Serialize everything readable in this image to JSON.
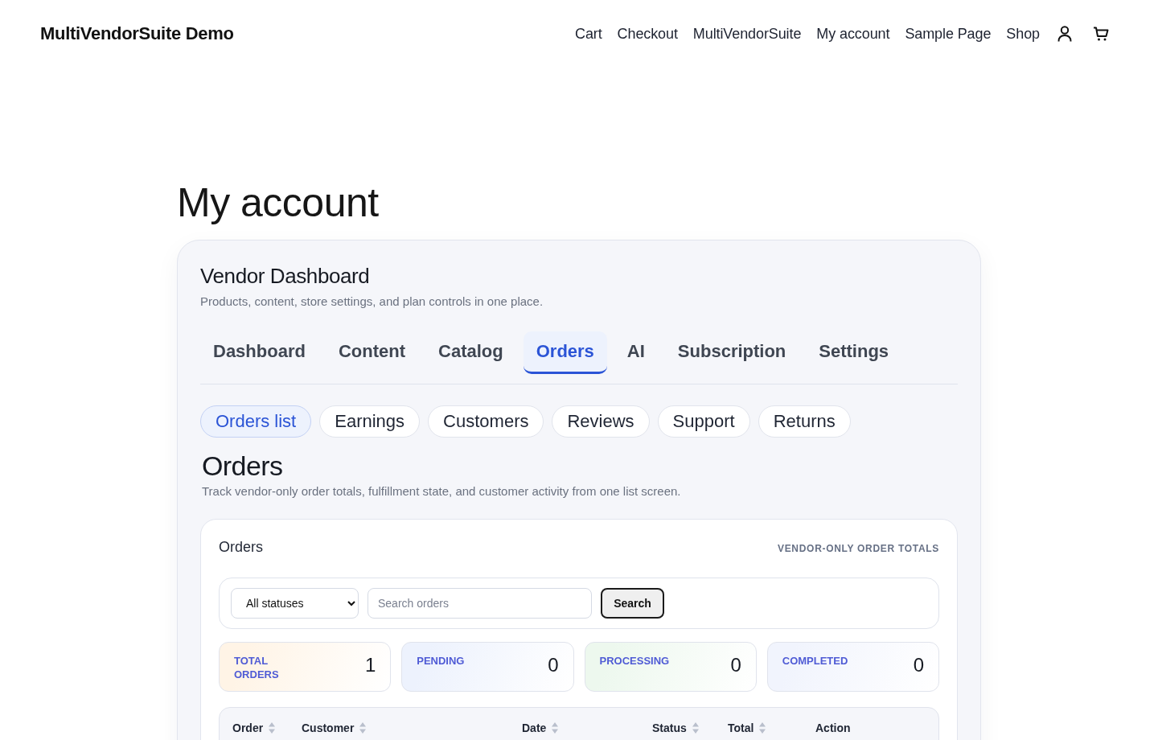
{
  "site": {
    "title": "MultiVendorSuite Demo",
    "nav": [
      "Cart",
      "Checkout",
      "MultiVendorSuite",
      "My account",
      "Sample Page",
      "Shop"
    ]
  },
  "page": {
    "title": "My account"
  },
  "dashboard": {
    "title": "Vendor Dashboard",
    "subtitle": "Products, content, store settings, and plan controls in one place.",
    "tabs": [
      {
        "label": "Dashboard",
        "selected": false
      },
      {
        "label": "Content",
        "selected": false
      },
      {
        "label": "Catalog",
        "selected": false
      },
      {
        "label": "Orders",
        "selected": true
      },
      {
        "label": "AI",
        "selected": false
      },
      {
        "label": "Subscription",
        "selected": false
      },
      {
        "label": "Settings",
        "selected": false
      }
    ],
    "subtabs": [
      {
        "label": "Orders list",
        "selected": true
      },
      {
        "label": "Earnings",
        "selected": false
      },
      {
        "label": "Customers",
        "selected": false
      },
      {
        "label": "Reviews",
        "selected": false
      },
      {
        "label": "Support",
        "selected": false
      },
      {
        "label": "Returns",
        "selected": false
      }
    ]
  },
  "section": {
    "title": "Orders",
    "description": "Track vendor-only order totals, fulfillment state, and customer activity from one list screen."
  },
  "orders_panel": {
    "title": "Orders",
    "badge": "VENDOR-ONLY ORDER TOTALS",
    "filter": {
      "status": "All statuses",
      "search_placeholder": "Search orders",
      "button": "Search"
    },
    "stats": [
      {
        "label": "TOTAL ORDERS",
        "value": "1",
        "color": "#fff4e6"
      },
      {
        "label": "PENDING",
        "value": "0",
        "color": "#edf2fd"
      },
      {
        "label": "PROCESSING",
        "value": "0",
        "color": "#edf8ee"
      },
      {
        "label": "COMPLETED",
        "value": "0",
        "color": "#f1f4fd"
      }
    ],
    "table": {
      "columns": [
        {
          "label": "Order",
          "sortable": true
        },
        {
          "label": "Customer",
          "sortable": true
        },
        {
          "label": "Date",
          "sortable": true
        },
        {
          "label": "Status",
          "sortable": true
        },
        {
          "label": "Total",
          "sortable": true
        },
        {
          "label": "Action",
          "sortable": false
        }
      ]
    }
  }
}
